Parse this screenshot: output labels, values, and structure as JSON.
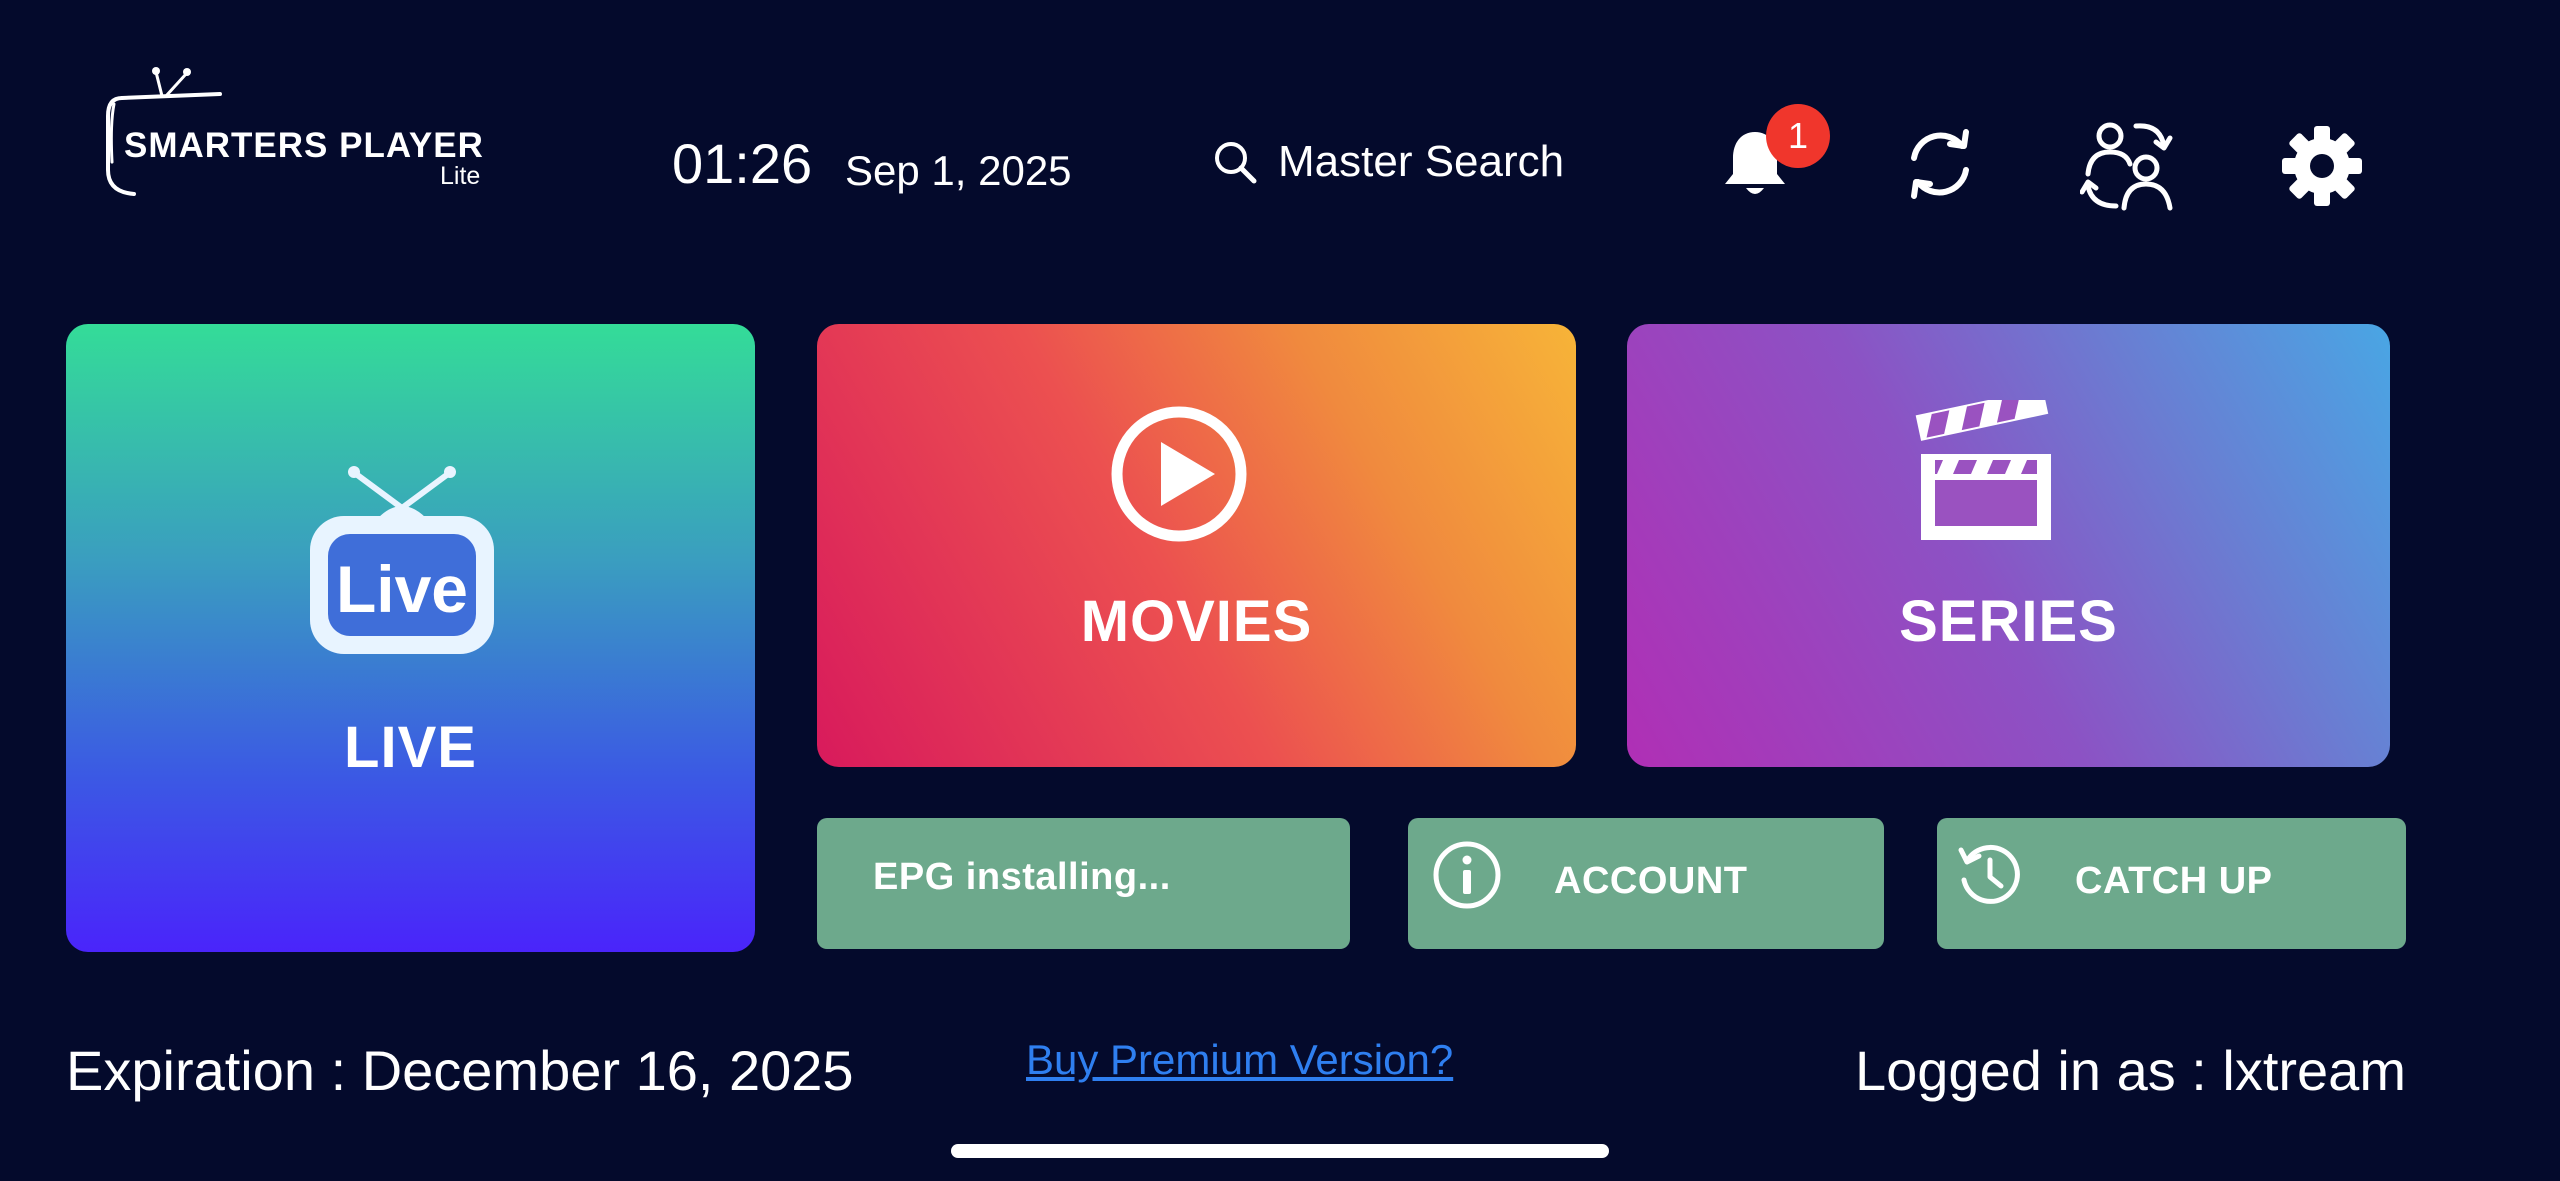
{
  "header": {
    "logo_title": "SMARTERS PLAYER",
    "logo_subtitle": "Lite",
    "time": "01:26",
    "date": "Sep 1, 2025",
    "search_label": "Master Search",
    "notification_count": "1"
  },
  "tiles": {
    "live": {
      "label": "LIVE",
      "icon_text": "Live",
      "icon": "live-tv-icon"
    },
    "movies": {
      "label": "MOVIES",
      "icon": "play-circle-icon"
    },
    "series": {
      "label": "SERIES",
      "icon": "clapperboard-icon"
    }
  },
  "small_tiles": {
    "epg": {
      "label": "EPG installing..."
    },
    "account": {
      "label": "ACCOUNT",
      "icon": "info-icon"
    },
    "catchup": {
      "label": "CATCH UP",
      "icon": "history-icon"
    }
  },
  "footer": {
    "expiration": "Expiration : December 16, 2025",
    "premium_link": "Buy Premium Version?",
    "logged_in": "Logged in as : lxtream"
  },
  "colors": {
    "background": "#040a2c",
    "badge": "#f0362c",
    "small_tile": "#6da98c",
    "link": "#2f7ff0"
  }
}
